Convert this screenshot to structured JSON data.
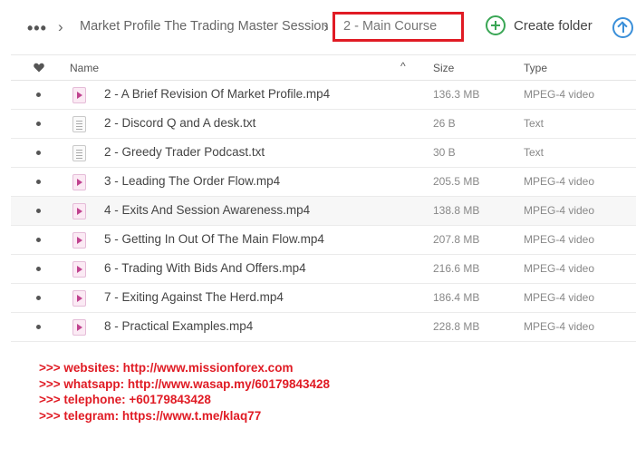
{
  "breadcrumb": {
    "more": "•••",
    "parent": "Market Profile The Trading Master Session",
    "current": "2 - Main Course"
  },
  "toolbar": {
    "create_folder": "Create folder"
  },
  "columns": {
    "name": "Name",
    "size": "Size",
    "type": "Type",
    "sort_indicator": "^"
  },
  "files": [
    {
      "name": "2 - A Brief Revision Of Market Profile.mp4",
      "size": "136.3 MB",
      "type": "MPEG-4 video",
      "icon": "video-file-icon"
    },
    {
      "name": "2 - Discord Q and A desk.txt",
      "size": "26 B",
      "type": "Text",
      "icon": "text-file-icon"
    },
    {
      "name": "2 - Greedy Trader Podcast.txt",
      "size": "30 B",
      "type": "Text",
      "icon": "text-file-icon"
    },
    {
      "name": "3 - Leading The Order Flow.mp4",
      "size": "205.5 MB",
      "type": "MPEG-4 video",
      "icon": "video-file-icon"
    },
    {
      "name": "4 - Exits And Session Awareness.mp4",
      "size": "138.8 MB",
      "type": "MPEG-4 video",
      "icon": "video-file-icon"
    },
    {
      "name": "5 - Getting In Out Of The Main Flow.mp4",
      "size": "207.8 MB",
      "type": "MPEG-4 video",
      "icon": "video-file-icon"
    },
    {
      "name": "6 - Trading With Bids And Offers.mp4",
      "size": "216.6 MB",
      "type": "MPEG-4 video",
      "icon": "video-file-icon"
    },
    {
      "name": "7 - Exiting Against The Herd.mp4",
      "size": "186.4 MB",
      "type": "MPEG-4 video",
      "icon": "video-file-icon"
    },
    {
      "name": "8 - Practical Examples.mp4",
      "size": "228.8 MB",
      "type": "MPEG-4 video",
      "icon": "video-file-icon"
    }
  ],
  "promo": [
    ">>> websites: http://www.missionforex.com",
    ">>> whatsapp: http://www.wasap.my/60179843428",
    ">>> telephone: +60179843428",
    ">>> telegram: https://www.t.me/klaq77"
  ],
  "colors": {
    "highlight_box": "#e01b24",
    "create_icon": "#3aa655",
    "upload_icon": "#3a8fd9",
    "promo_text": "#e01b24"
  }
}
